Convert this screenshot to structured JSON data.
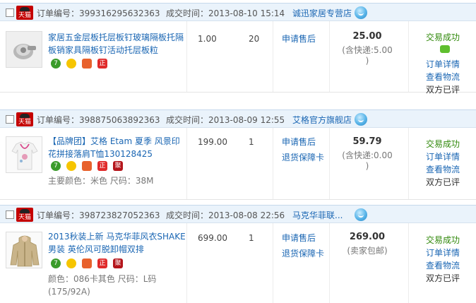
{
  "labels": {
    "order_no": "订单编号：",
    "deal_time": "成交时间：",
    "tmall": "天猫"
  },
  "orders": [
    {
      "order_no": "399316295632363",
      "time": "2013-08-10 15:14",
      "shop": "诚迅家居专营店",
      "title": "家居五金层板托层板钉玻璃隔板托隔板销家具隔板钉活动托层板粒",
      "attr": "",
      "price": "1.00",
      "qty": "20",
      "after_sale": [
        "申请售后"
      ],
      "total": "25.00",
      "shipping": "(含快递:5.00 )",
      "status": "交易成功",
      "links": [
        "订单详情",
        "查看物流"
      ],
      "rated": "双方已评",
      "badges": [
        "7",
        "",
        "",
        "正"
      ]
    },
    {
      "order_no": "398875063892363",
      "time": "2013-08-09 12:55",
      "shop": "艾格官方旗舰店",
      "title": "【品牌团】艾格 Etam 夏季 风景印花拼接落肩T恤130128425",
      "attr": "主要颜色：米色 尺码：38M",
      "price": "199.00",
      "qty": "1",
      "after_sale": [
        "申请售后",
        "退货保障卡"
      ],
      "total": "59.79",
      "shipping": "(含快递:0.00 )",
      "status": "交易成功",
      "links": [
        "订单详情",
        "查看物流"
      ],
      "rated": "双方已评",
      "badges": [
        "7",
        "",
        "",
        "正",
        "聚"
      ]
    },
    {
      "order_no": "398723827052363",
      "time": "2013-08-08 22:56",
      "shop": "马克华菲联...",
      "title": "2013秋装上新 马克华菲风衣SHAKE男装 英伦风可脱卸帽双排",
      "attr": "颜色：086卡其色 尺码：L码(175/92A)",
      "price": "699.00",
      "qty": "1",
      "after_sale": [
        "申请售后",
        "退货保障卡"
      ],
      "total": "269.00",
      "shipping": "(卖家包邮)",
      "status": "交易成功",
      "links": [
        "订单详情",
        "查看物流"
      ],
      "rated": "双方已评",
      "badges": [
        "7",
        "",
        "",
        "正",
        "聚"
      ]
    }
  ]
}
